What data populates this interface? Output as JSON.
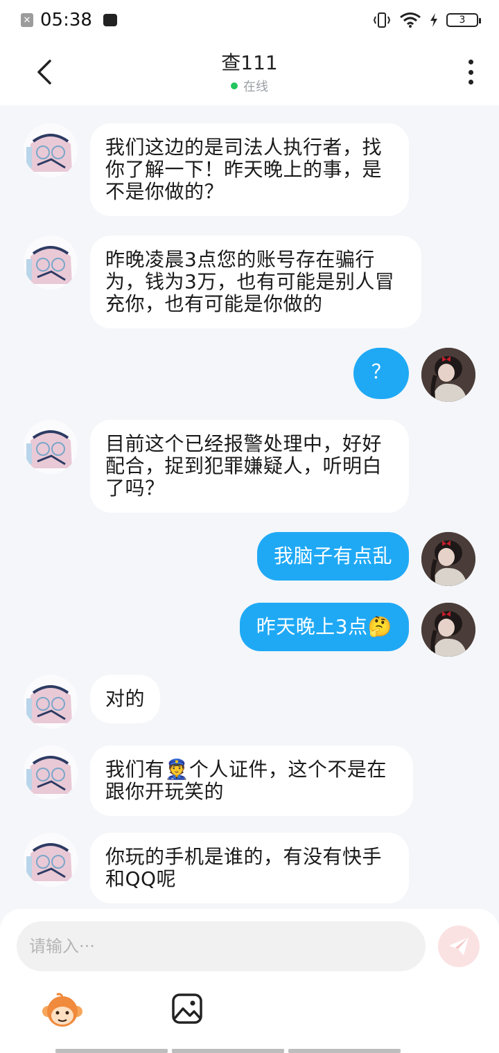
{
  "status_bar": {
    "time": "05:38",
    "battery": "3"
  },
  "header": {
    "title": "查111",
    "status": "在线"
  },
  "messages": [
    {
      "side": "left",
      "text": "我们这边的是司法人执行者，找你了解一下！昨天晚上的事，是不是你做的？"
    },
    {
      "side": "left",
      "text": "昨晚凌晨3点您的账号存在骗行为，钱为3万，也有可能是别人冒充你，也有可能是你做的"
    },
    {
      "side": "right",
      "text": "？"
    },
    {
      "side": "left",
      "text": "目前这个已经报警处理中，好好配合，捉到犯罪嫌疑人，听明白了吗？"
    },
    {
      "side": "right",
      "text": "我脑子有点乱"
    },
    {
      "side": "right",
      "text": "昨天晚上3点",
      "emoji": "🤔"
    },
    {
      "side": "left",
      "text": "对的"
    },
    {
      "side": "left",
      "text_before": "我们有",
      "emoji": "👮",
      "text_after": "个人证件，这个不是在跟你开玩笑的"
    },
    {
      "side": "left",
      "text": "你玩的手机是谁的，有没有快手和QQ呢"
    }
  ],
  "input": {
    "placeholder": "请输入···"
  },
  "colors": {
    "accent": "#1fa9f5",
    "online": "#22c55e",
    "send": "#fbe2e2"
  }
}
